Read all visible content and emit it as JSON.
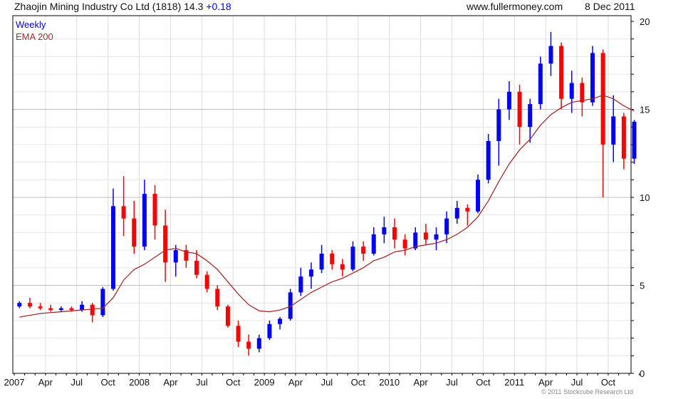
{
  "header": {
    "title": "Zhaojin Mining Industry Co Ltd (1818) 14.3",
    "change": "+0.18",
    "site": "www.fullermoney.com",
    "date": "8 Dec 2011"
  },
  "copyright": "© 2011 Stockcube Research Ltd",
  "colors": {
    "up": "#0000ff",
    "down": "#ff0000",
    "ema": "#a52a2a",
    "legend_weekly": "#0000cc",
    "legend_ema": "#a52a2a"
  },
  "chart_data": {
    "type": "candlestick",
    "legend": [
      "Weekly",
      "EMA 200"
    ],
    "legend_position": "top-left",
    "ylim": [
      0,
      20
    ],
    "y_ticks": [
      "0",
      "5",
      "10",
      "15",
      "20"
    ],
    "x_ticks": [
      "2007",
      "Apr",
      "Jul",
      "Oct",
      "2008",
      "Apr",
      "Jul",
      "Oct",
      "2009",
      "Apr",
      "Jul",
      "Oct",
      "2010",
      "Apr",
      "Jul",
      "Oct",
      "2011",
      "Apr",
      "Jul",
      "Oct"
    ],
    "grid": true,
    "periods": "monthly approximation of weekly bars, Jan 2007 – Dec 2011",
    "ohlc": [
      [
        3.8,
        4.1,
        3.7,
        4.0
      ],
      [
        4.0,
        4.3,
        3.7,
        3.8
      ],
      [
        3.8,
        4.0,
        3.6,
        3.7
      ],
      [
        3.7,
        3.9,
        3.5,
        3.6
      ],
      [
        3.6,
        3.8,
        3.5,
        3.7
      ],
      [
        3.7,
        3.8,
        3.5,
        3.6
      ],
      [
        3.6,
        4.1,
        3.5,
        3.9
      ],
      [
        3.9,
        4.0,
        2.9,
        3.3
      ],
      [
        3.3,
        4.9,
        3.2,
        4.8
      ],
      [
        4.8,
        10.5,
        4.7,
        9.5
      ],
      [
        9.5,
        11.2,
        7.8,
        8.8
      ],
      [
        8.8,
        9.8,
        6.8,
        7.2
      ],
      [
        7.2,
        11.0,
        7.0,
        10.2
      ],
      [
        10.2,
        10.7,
        7.6,
        8.4
      ],
      [
        8.4,
        9.3,
        5.2,
        6.3
      ],
      [
        6.3,
        7.3,
        5.5,
        7.0
      ],
      [
        7.0,
        7.3,
        6.0,
        6.4
      ],
      [
        6.4,
        7.0,
        5.4,
        5.6
      ],
      [
        5.6,
        5.8,
        4.6,
        4.8
      ],
      [
        4.8,
        5.0,
        3.6,
        3.8
      ],
      [
        3.8,
        3.9,
        2.6,
        2.7
      ],
      [
        2.7,
        3.0,
        1.5,
        1.8
      ],
      [
        1.8,
        2.2,
        1.0,
        1.4
      ],
      [
        1.4,
        2.2,
        1.2,
        2.0
      ],
      [
        2.0,
        3.0,
        1.9,
        2.8
      ],
      [
        2.8,
        3.2,
        2.5,
        3.1
      ],
      [
        3.1,
        4.8,
        3.0,
        4.6
      ],
      [
        4.6,
        6.0,
        4.4,
        5.5
      ],
      [
        5.5,
        6.3,
        4.8,
        5.9
      ],
      [
        5.9,
        7.3,
        5.7,
        6.8
      ],
      [
        6.8,
        7.0,
        5.9,
        6.2
      ],
      [
        6.2,
        6.5,
        5.5,
        5.9
      ],
      [
        5.9,
        7.5,
        5.8,
        7.2
      ],
      [
        7.2,
        7.5,
        6.4,
        6.8
      ],
      [
        6.8,
        8.3,
        6.7,
        7.9
      ],
      [
        7.9,
        8.9,
        7.4,
        8.3
      ],
      [
        8.3,
        8.8,
        7.1,
        7.6
      ],
      [
        7.6,
        7.9,
        6.7,
        7.1
      ],
      [
        7.1,
        8.3,
        7.0,
        8.0
      ],
      [
        8.0,
        8.5,
        7.3,
        7.6
      ],
      [
        7.6,
        8.3,
        7.0,
        7.9
      ],
      [
        7.9,
        9.2,
        7.4,
        8.8
      ],
      [
        8.8,
        9.8,
        8.5,
        9.4
      ],
      [
        9.4,
        9.6,
        8.4,
        9.2
      ],
      [
        9.2,
        11.3,
        9.1,
        11.0
      ],
      [
        11.0,
        13.6,
        10.8,
        13.2
      ],
      [
        13.2,
        15.6,
        11.8,
        15.0
      ],
      [
        15.0,
        16.6,
        14.4,
        16.0
      ],
      [
        16.0,
        16.4,
        13.0,
        14.0
      ],
      [
        14.0,
        15.6,
        13.1,
        15.3
      ],
      [
        15.3,
        18.0,
        15.0,
        17.6
      ],
      [
        17.6,
        19.4,
        16.9,
        18.6
      ],
      [
        18.6,
        18.8,
        15.0,
        15.6
      ],
      [
        15.6,
        17.2,
        14.8,
        16.5
      ],
      [
        16.5,
        16.8,
        14.6,
        15.4
      ],
      [
        15.4,
        18.6,
        15.2,
        18.2
      ],
      [
        18.2,
        18.4,
        10.0,
        13.0
      ],
      [
        13.0,
        15.8,
        12.0,
        14.6
      ],
      [
        14.6,
        14.8,
        11.6,
        12.2
      ],
      [
        12.2,
        14.4,
        11.9,
        14.3
      ]
    ],
    "ema200": [
      3.2,
      3.3,
      3.4,
      3.45,
      3.5,
      3.55,
      3.6,
      3.65,
      3.7,
      4.3,
      5.3,
      5.9,
      6.2,
      6.6,
      7.0,
      7.1,
      6.9,
      6.8,
      6.4,
      5.9,
      5.2,
      4.5,
      3.9,
      3.55,
      3.5,
      3.6,
      3.8,
      4.2,
      4.6,
      4.9,
      5.2,
      5.4,
      5.7,
      6.0,
      6.4,
      6.6,
      6.9,
      7.0,
      7.2,
      7.3,
      7.4,
      7.6,
      7.9,
      8.3,
      8.9,
      9.8,
      10.9,
      11.9,
      12.7,
      13.3,
      14.1,
      14.7,
      15.1,
      15.4,
      15.5,
      15.6,
      15.8,
      15.6,
      15.2,
      14.9
    ]
  }
}
